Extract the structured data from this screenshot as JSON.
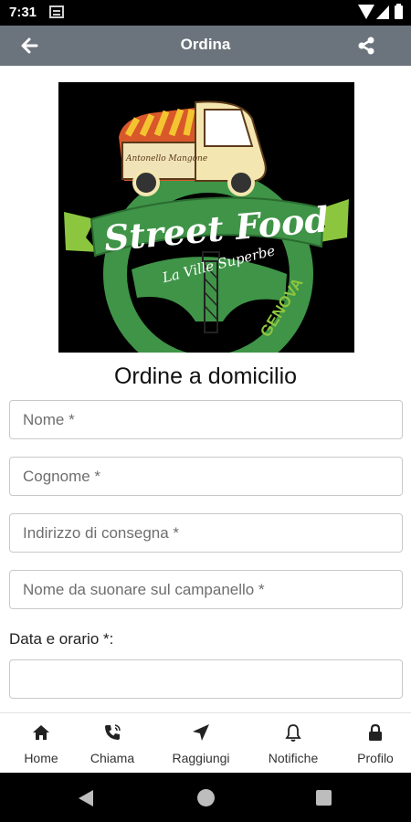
{
  "status_bar": {
    "time": "7:31",
    "icons": [
      "notification-icon",
      "wifi-icon",
      "signal-icon",
      "battery-icon"
    ]
  },
  "app_bar": {
    "title": "Ordina",
    "back_icon": "arrow-left-icon",
    "share_icon": "share-icon",
    "color": "#6b747c"
  },
  "logo": {
    "headline": "Street Food",
    "subline": "La Ville Superbe",
    "city": "GENOVA",
    "truck_sign": "Antonello Mangone"
  },
  "form": {
    "heading": "Ordine a domicilio",
    "fields": [
      {
        "placeholder": "Nome *",
        "value": ""
      },
      {
        "placeholder": "Cognome *",
        "value": ""
      },
      {
        "placeholder": "Indirizzo di consegna *",
        "value": ""
      },
      {
        "placeholder": "Nome da suonare sul campanello *",
        "value": ""
      }
    ],
    "datetime_label": "Data e orario *:",
    "datetime_value": ""
  },
  "bottom_nav": {
    "items": [
      {
        "label": "Home",
        "icon": "home-icon"
      },
      {
        "label": "Chiama",
        "icon": "phone-icon"
      },
      {
        "label": "Raggiungi",
        "icon": "location-arrow-icon"
      },
      {
        "label": "Notifiche",
        "icon": "bell-icon"
      },
      {
        "label": "Profilo",
        "icon": "lock-icon"
      }
    ]
  },
  "system_nav": {
    "icons": [
      "system-back-icon",
      "system-home-icon",
      "system-recents-icon"
    ]
  },
  "colors": {
    "logo_green": "#3f9447",
    "logo_light_green": "#8cc63f"
  }
}
